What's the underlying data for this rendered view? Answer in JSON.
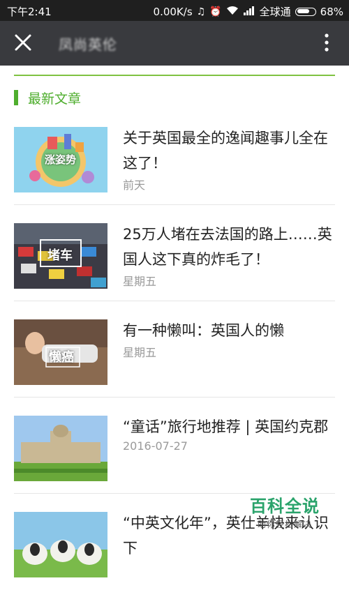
{
  "status_bar": {
    "time": "下午2:41",
    "speed": "0.00K/s",
    "carrier": "全球通",
    "battery": "68%"
  },
  "nav": {
    "title": "凤尚英伦",
    "close_icon": "close-icon",
    "more_icon": "more-vertical-icon"
  },
  "section": {
    "title": "最新文章",
    "accent_color": "#4fae2e"
  },
  "articles": [
    {
      "title": "关于英国最全的逸闻趣事儿全在这了！",
      "date": "前天",
      "thumb_label": "涨姿势"
    },
    {
      "title": "25万人堵在去法国的路上……英国人这下真的炸毛了！",
      "date": "星期五",
      "thumb_label": "堵车"
    },
    {
      "title": "有一种懒叫：英国人的懒",
      "date": "星期五",
      "thumb_label": "懒癌"
    },
    {
      "title": "“童话”旅行地推荐 | 英国约克郡",
      "date": "2016-07-27",
      "thumb_label": ""
    },
    {
      "title": "“中英文化年”，英仕羊快来认识下",
      "date": "",
      "thumb_label": ""
    }
  ],
  "watermark": {
    "title": "百科全说",
    "subtitle": "助你轻松解决"
  }
}
